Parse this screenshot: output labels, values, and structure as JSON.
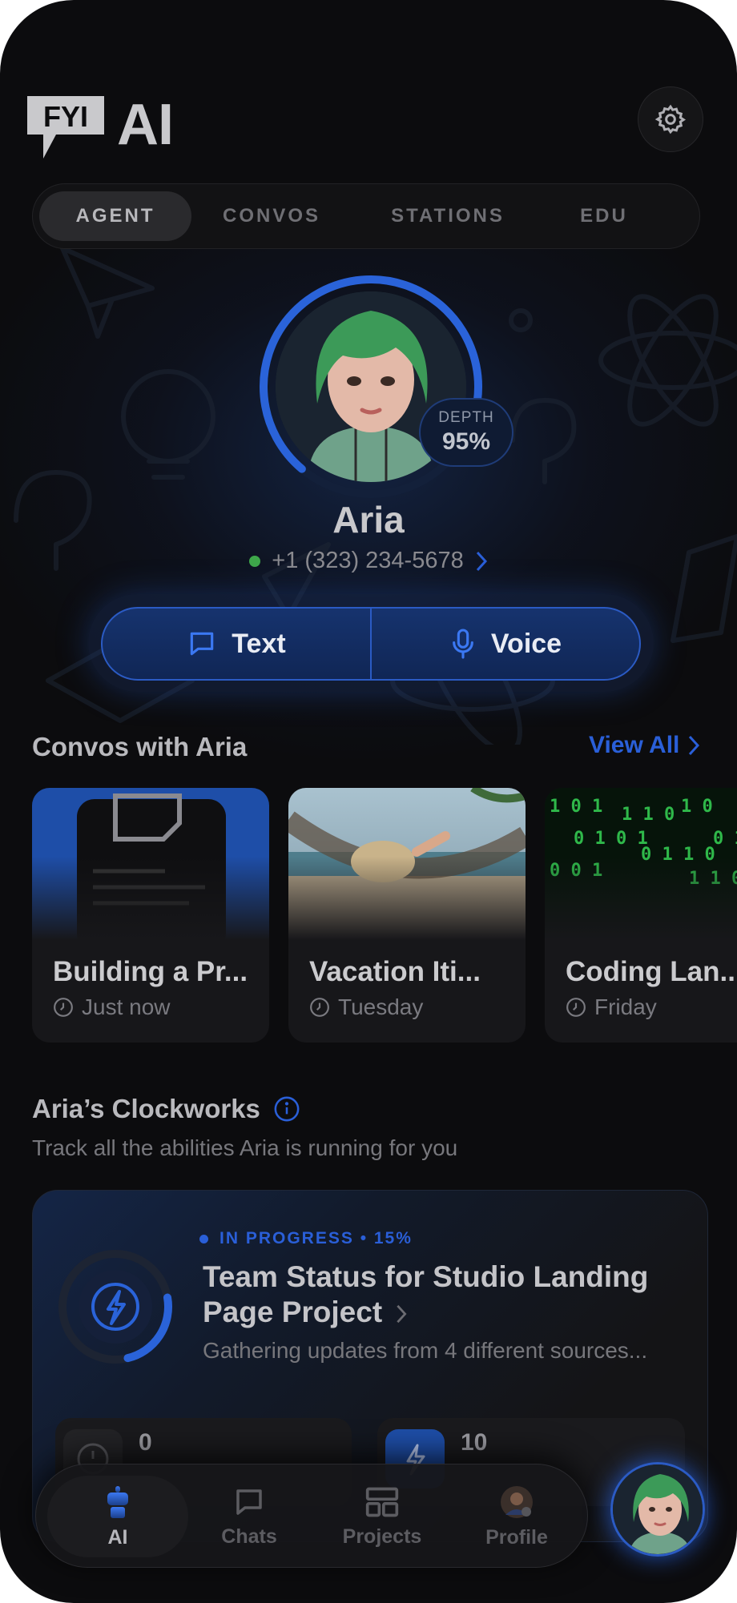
{
  "app": {
    "logo_badge": "FYI",
    "logo_text": "AI"
  },
  "tabs": [
    {
      "label": "AGENT",
      "active": true
    },
    {
      "label": "CONVOS",
      "active": false
    },
    {
      "label": "STATIONS",
      "active": false
    },
    {
      "label": "EDU",
      "active": false
    }
  ],
  "agent": {
    "name": "Aria",
    "phone": "+1 (323) 234-5678",
    "status_color": "#3ea84a",
    "depth_label": "DEPTH",
    "depth_value": "95%",
    "depth_fraction": 0.95
  },
  "actions": {
    "text_label": "Text",
    "voice_label": "Voice"
  },
  "convos": {
    "title": "Convos with Aria",
    "view_all": "View All",
    "cards": [
      {
        "title": "Building a Pr...",
        "time": "Just now",
        "image": "document-icon"
      },
      {
        "title": "Vacation Iti...",
        "time": "Tuesday",
        "image": "hammock-beach-photo"
      },
      {
        "title": "Coding Lan...",
        "time": "Friday",
        "image": "binary-code-photo"
      }
    ]
  },
  "clockworks": {
    "title": "Aria’s Clockworks",
    "subtitle": "Track all the abilities Aria is running for you",
    "task": {
      "status": "IN PROGRESS • 15%",
      "progress": 0.15,
      "title": "Team Status for Studio Landing Page Project",
      "description": "Gathering updates from 4 different sources...",
      "stats": [
        {
          "value": "0"
        },
        {
          "value": "10"
        }
      ]
    }
  },
  "nav": [
    {
      "label": "AI",
      "active": true
    },
    {
      "label": "Chats",
      "active": false
    },
    {
      "label": "Projects",
      "active": false
    },
    {
      "label": "Profile",
      "active": false
    }
  ],
  "colors": {
    "accent": "#2a5fd8",
    "background": "#0c0c0e",
    "online": "#3ea84a"
  }
}
